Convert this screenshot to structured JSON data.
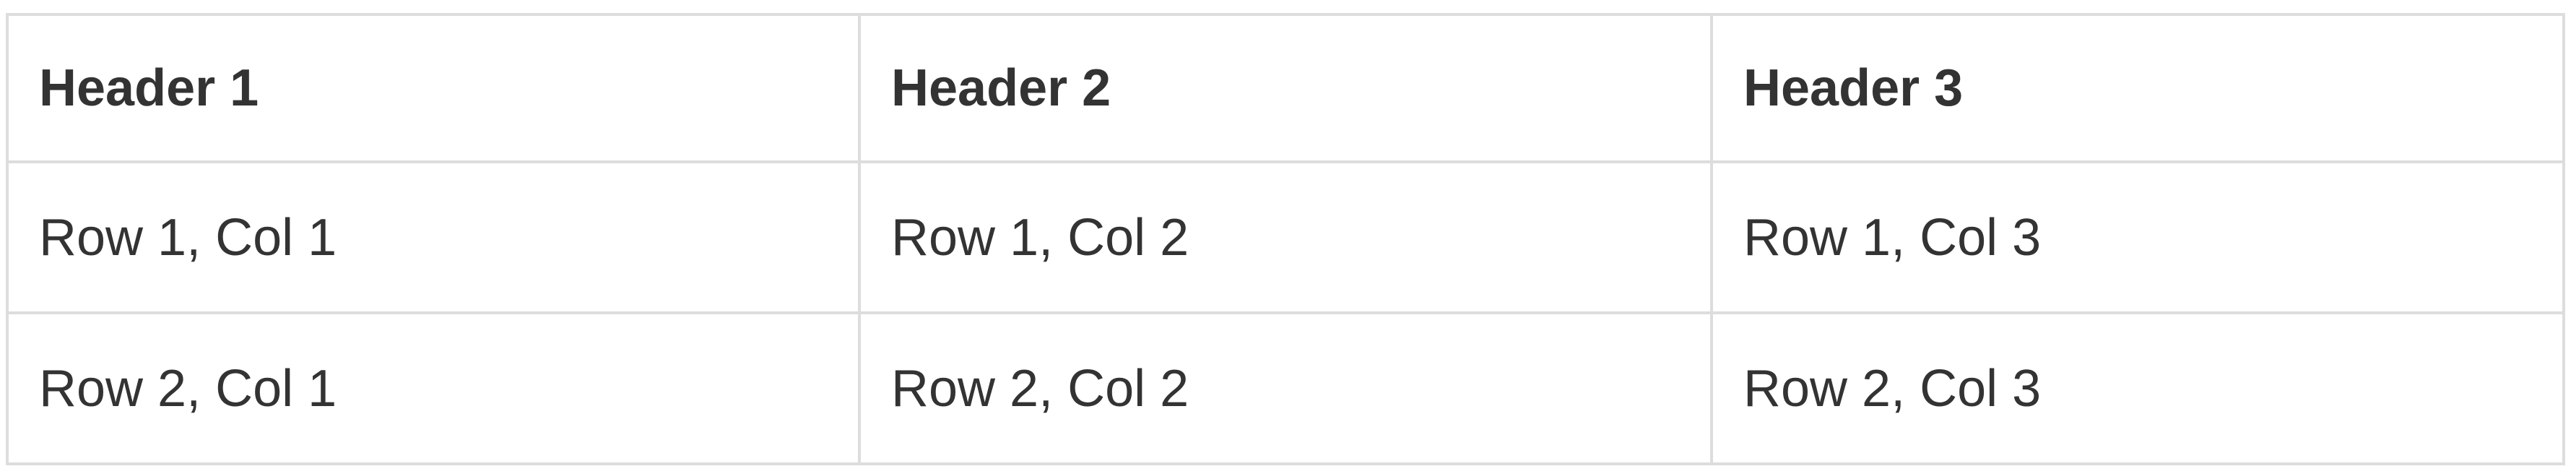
{
  "table": {
    "headers": [
      "Header 1",
      "Header 2",
      "Header 3"
    ],
    "rows": [
      [
        "Row 1, Col 1",
        "Row 1, Col 2",
        "Row 1, Col 3"
      ],
      [
        "Row 2, Col 1",
        "Row 2, Col 2",
        "Row 2, Col 3"
      ]
    ]
  }
}
